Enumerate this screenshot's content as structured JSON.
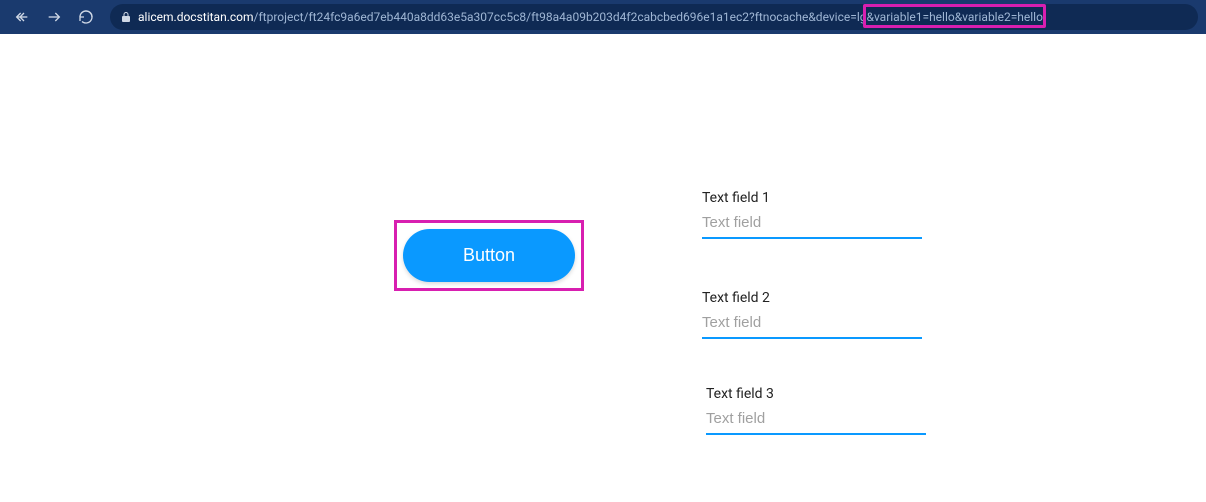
{
  "browser": {
    "url_host": "alicem.docstitan.com",
    "url_path": "/ftproject/ft24fc9a6ed7eb440a8dd63e5a307cc5c8/ft98a4a09b203d4f2cabcbed696e1a1ec2?ftnocache&device=lg",
    "url_highlighted": "&variable1=hello&variable2=hello"
  },
  "content": {
    "button_label": "Button",
    "fields": [
      {
        "label": "Text field 1",
        "placeholder": "Text field",
        "value": ""
      },
      {
        "label": "Text field 2",
        "placeholder": "Text field",
        "value": ""
      },
      {
        "label": "Text field 3",
        "placeholder": "Text field",
        "value": ""
      }
    ]
  },
  "highlight_box": {
    "url_fragment": true,
    "button": true
  },
  "colors": {
    "accent": "#0a99ff",
    "highlight": "#d81fb0",
    "chrome_bg": "#1a3a6e"
  }
}
